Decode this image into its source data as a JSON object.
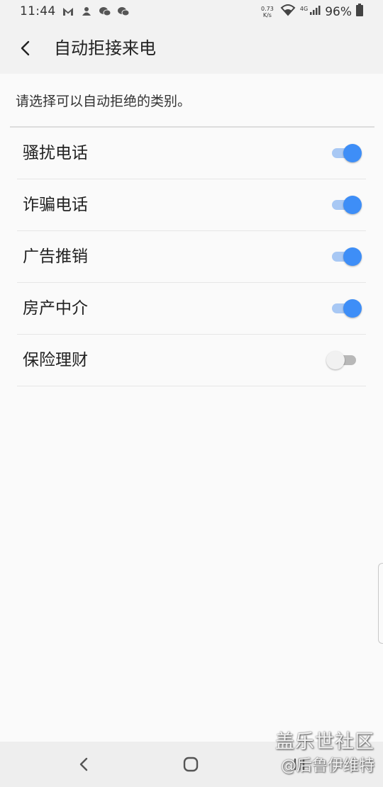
{
  "status_bar": {
    "time": "11:44",
    "net_speed_value": "0.73",
    "net_speed_unit": "K/s",
    "network_type": "4G",
    "battery": "96%",
    "app_icons": [
      "gmail-icon",
      "notification-icon",
      "wechat-icon",
      "wechat-icon"
    ]
  },
  "header": {
    "title": "自动拒接来电"
  },
  "description": "请选择可以自动拒绝的类别。",
  "categories": [
    {
      "label": "骚扰电话",
      "enabled": true
    },
    {
      "label": "诈骗电话",
      "enabled": true
    },
    {
      "label": "广告推销",
      "enabled": true
    },
    {
      "label": "房产中介",
      "enabled": true
    },
    {
      "label": "保险理财",
      "enabled": false
    }
  ],
  "watermark": {
    "main": "盖乐世社区",
    "sub": "@后鲁伊维特"
  },
  "colors": {
    "accent": "#3e8ef7",
    "accent_track": "#a8c8f4",
    "off_thumb": "#f1f1f1",
    "off_track": "#b8b8b8",
    "background": "#fafafa",
    "header_bg": "#f2f2f2"
  }
}
